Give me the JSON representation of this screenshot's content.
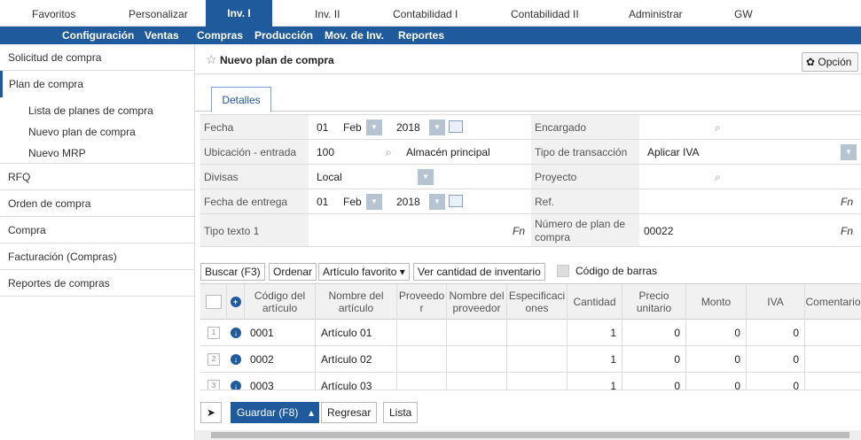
{
  "topmenu": [
    "Favoritos",
    "Personalizar",
    "Inv. I",
    "Inv. II",
    "Contabilidad I",
    "Contabilidad II",
    "Administrar",
    "GW"
  ],
  "submenu": [
    "Configuración",
    "Ventas",
    "Compras",
    "Producción",
    "Mov. de Inv.",
    "Reportes"
  ],
  "sidebar": {
    "items": [
      "Solicitud de compra",
      "Plan de compra",
      "Lista de planes de compra",
      "Nuevo plan de compra",
      "Nuevo MRP",
      "RFQ",
      "Orden de compra",
      "Compra",
      "Facturación (Compras)",
      "Reportes de compras"
    ]
  },
  "page": {
    "title": "Nuevo plan de compra",
    "option": "Opción",
    "tab": "Detalles"
  },
  "form": {
    "fecha_label": "Fecha",
    "fecha_day": "01",
    "fecha_month": "Feb",
    "fecha_year": "2018",
    "encargado_label": "Encargado",
    "ubic_label": "Ubicación - entrada",
    "ubic_code": "100",
    "ubic_name": "Almacén principal",
    "tipo_trans_label": "Tipo de transacción",
    "tipo_trans_value": "Aplicar IVA",
    "divisas_label": "Divisas",
    "divisas_value": "Local",
    "proyecto_label": "Proyecto",
    "entrega_label": "Fecha de entrega",
    "entrega_day": "01",
    "entrega_month": "Feb",
    "entrega_year": "2018",
    "ref_label": "Ref.",
    "fn": "Fn",
    "tipo_texto_label": "Tipo texto 1",
    "num_plan_label": "Número de plan de compra",
    "num_plan_value": "00022"
  },
  "toolbar": {
    "buscar": "Buscar (F3)",
    "ordenar": "Ordenar",
    "favorito": "Artículo favorito ▾",
    "ver": "Ver cantidad de inventario",
    "codigo": "Código de barras"
  },
  "grid": {
    "headers": [
      "Código del artículo",
      "Nombre del artículo",
      "Proveedor",
      "Nombre del proveedor",
      "Especificaciones",
      "Cantidad",
      "Precio unitario",
      "Monto",
      "IVA",
      "Comentarios"
    ],
    "rows": [
      {
        "n": "1",
        "code": "0001",
        "name": "Artículo 01",
        "qty": "1",
        "price": "0",
        "amount": "0",
        "iva": "0"
      },
      {
        "n": "2",
        "code": "0002",
        "name": "Artículo 02",
        "qty": "1",
        "price": "0",
        "amount": "0",
        "iva": "0"
      },
      {
        "n": "3",
        "code": "0003",
        "name": "Artículo 03",
        "qty": "1",
        "price": "0",
        "amount": "0",
        "iva": "0"
      }
    ]
  },
  "bottom": {
    "guardar": "Guardar (F8)",
    "regresar": "Regresar",
    "lista": "Lista"
  }
}
